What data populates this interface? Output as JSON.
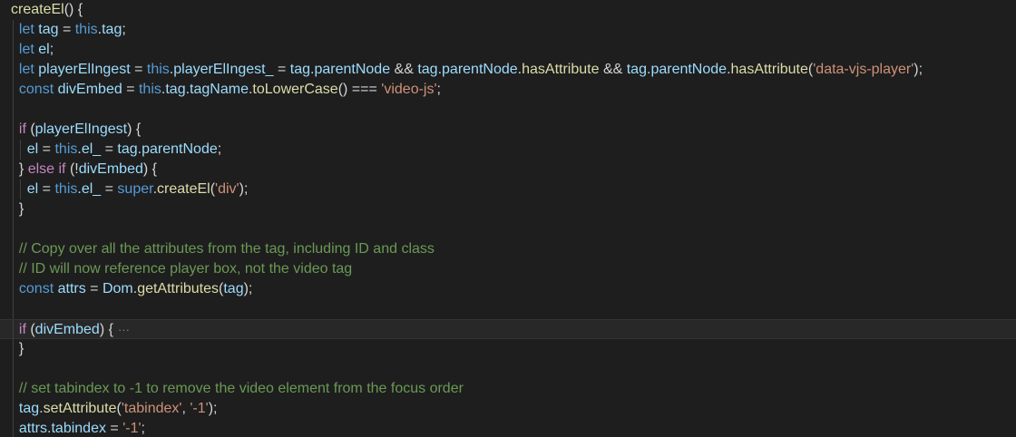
{
  "editor": {
    "lines": [
      [
        {
          "t": "createEl",
          "c": "fn"
        },
        {
          "t": "() {",
          "c": "pun"
        }
      ],
      [
        {
          "t": "  ",
          "c": "pun"
        },
        {
          "t": "let",
          "c": "kw"
        },
        {
          "t": " ",
          "c": "pun"
        },
        {
          "t": "tag",
          "c": "var"
        },
        {
          "t": " = ",
          "c": "pun"
        },
        {
          "t": "this",
          "c": "this"
        },
        {
          "t": ".",
          "c": "pun"
        },
        {
          "t": "tag",
          "c": "prop"
        },
        {
          "t": ";",
          "c": "pun"
        }
      ],
      [
        {
          "t": "  ",
          "c": "pun"
        },
        {
          "t": "let",
          "c": "kw"
        },
        {
          "t": " ",
          "c": "pun"
        },
        {
          "t": "el",
          "c": "var"
        },
        {
          "t": ";",
          "c": "pun"
        }
      ],
      [
        {
          "t": "  ",
          "c": "pun"
        },
        {
          "t": "let",
          "c": "kw"
        },
        {
          "t": " ",
          "c": "pun"
        },
        {
          "t": "playerElIngest",
          "c": "var"
        },
        {
          "t": " = ",
          "c": "pun"
        },
        {
          "t": "this",
          "c": "this"
        },
        {
          "t": ".",
          "c": "pun"
        },
        {
          "t": "playerElIngest_",
          "c": "prop"
        },
        {
          "t": " = ",
          "c": "pun"
        },
        {
          "t": "tag",
          "c": "var"
        },
        {
          "t": ".",
          "c": "pun"
        },
        {
          "t": "parentNode",
          "c": "prop"
        },
        {
          "t": " && ",
          "c": "pun"
        },
        {
          "t": "tag",
          "c": "var"
        },
        {
          "t": ".",
          "c": "pun"
        },
        {
          "t": "parentNode",
          "c": "prop"
        },
        {
          "t": ".",
          "c": "pun"
        },
        {
          "t": "hasAttribute",
          "c": "fn"
        },
        {
          "t": " && ",
          "c": "pun"
        },
        {
          "t": "tag",
          "c": "var"
        },
        {
          "t": ".",
          "c": "pun"
        },
        {
          "t": "parentNode",
          "c": "prop"
        },
        {
          "t": ".",
          "c": "pun"
        },
        {
          "t": "hasAttribute",
          "c": "fn"
        },
        {
          "t": "(",
          "c": "pun"
        },
        {
          "t": "'data-vjs-player'",
          "c": "str"
        },
        {
          "t": ");",
          "c": "pun"
        }
      ],
      [
        {
          "t": "  ",
          "c": "pun"
        },
        {
          "t": "const",
          "c": "kw"
        },
        {
          "t": " ",
          "c": "pun"
        },
        {
          "t": "divEmbed",
          "c": "var"
        },
        {
          "t": " = ",
          "c": "pun"
        },
        {
          "t": "this",
          "c": "this"
        },
        {
          "t": ".",
          "c": "pun"
        },
        {
          "t": "tag",
          "c": "prop"
        },
        {
          "t": ".",
          "c": "pun"
        },
        {
          "t": "tagName",
          "c": "prop"
        },
        {
          "t": ".",
          "c": "pun"
        },
        {
          "t": "toLowerCase",
          "c": "fn"
        },
        {
          "t": "() === ",
          "c": "pun"
        },
        {
          "t": "'video-js'",
          "c": "str"
        },
        {
          "t": ";",
          "c": "pun"
        }
      ],
      [],
      [
        {
          "t": "  ",
          "c": "pun"
        },
        {
          "t": "if",
          "c": "ctl"
        },
        {
          "t": " (",
          "c": "pun"
        },
        {
          "t": "playerElIngest",
          "c": "var"
        },
        {
          "t": ") {",
          "c": "pun"
        }
      ],
      [
        {
          "t": "    ",
          "c": "pun"
        },
        {
          "t": "el",
          "c": "var"
        },
        {
          "t": " = ",
          "c": "pun"
        },
        {
          "t": "this",
          "c": "this"
        },
        {
          "t": ".",
          "c": "pun"
        },
        {
          "t": "el_",
          "c": "prop"
        },
        {
          "t": " = ",
          "c": "pun"
        },
        {
          "t": "tag",
          "c": "var"
        },
        {
          "t": ".",
          "c": "pun"
        },
        {
          "t": "parentNode",
          "c": "prop"
        },
        {
          "t": ";",
          "c": "pun"
        }
      ],
      [
        {
          "t": "  } ",
          "c": "pun"
        },
        {
          "t": "else",
          "c": "ctl"
        },
        {
          "t": " ",
          "c": "pun"
        },
        {
          "t": "if",
          "c": "ctl"
        },
        {
          "t": " (!",
          "c": "pun"
        },
        {
          "t": "divEmbed",
          "c": "var"
        },
        {
          "t": ") {",
          "c": "pun"
        }
      ],
      [
        {
          "t": "    ",
          "c": "pun"
        },
        {
          "t": "el",
          "c": "var"
        },
        {
          "t": " = ",
          "c": "pun"
        },
        {
          "t": "this",
          "c": "this"
        },
        {
          "t": ".",
          "c": "pun"
        },
        {
          "t": "el_",
          "c": "prop"
        },
        {
          "t": " = ",
          "c": "pun"
        },
        {
          "t": "super",
          "c": "kw"
        },
        {
          "t": ".",
          "c": "pun"
        },
        {
          "t": "createEl",
          "c": "fn"
        },
        {
          "t": "(",
          "c": "pun"
        },
        {
          "t": "'div'",
          "c": "str"
        },
        {
          "t": ");",
          "c": "pun"
        }
      ],
      [
        {
          "t": "  }",
          "c": "pun"
        }
      ],
      [],
      [
        {
          "t": "  ",
          "c": "pun"
        },
        {
          "t": "// Copy over all the attributes from the tag, including ID and class",
          "c": "cmt"
        }
      ],
      [
        {
          "t": "  ",
          "c": "pun"
        },
        {
          "t": "// ID will now reference player box, not the video tag",
          "c": "cmt"
        }
      ],
      [
        {
          "t": "  ",
          "c": "pun"
        },
        {
          "t": "const",
          "c": "kw"
        },
        {
          "t": " ",
          "c": "pun"
        },
        {
          "t": "attrs",
          "c": "var"
        },
        {
          "t": " = ",
          "c": "pun"
        },
        {
          "t": "Dom",
          "c": "var"
        },
        {
          "t": ".",
          "c": "pun"
        },
        {
          "t": "getAttributes",
          "c": "fn"
        },
        {
          "t": "(",
          "c": "pun"
        },
        {
          "t": "tag",
          "c": "var"
        },
        {
          "t": ");",
          "c": "pun"
        }
      ],
      [],
      [
        {
          "t": "  ",
          "c": "pun"
        },
        {
          "t": "if",
          "c": "ctl"
        },
        {
          "t": " (",
          "c": "pun"
        },
        {
          "t": "divEmbed",
          "c": "var"
        },
        {
          "t": ") {",
          "c": "pun"
        }
      ],
      [
        {
          "t": "  }",
          "c": "pun"
        }
      ],
      [],
      [
        {
          "t": "  ",
          "c": "pun"
        },
        {
          "t": "// set tabindex to -1 to remove the video element from the focus order",
          "c": "cmt"
        }
      ],
      [
        {
          "t": "  ",
          "c": "pun"
        },
        {
          "t": "tag",
          "c": "var"
        },
        {
          "t": ".",
          "c": "pun"
        },
        {
          "t": "setAttribute",
          "c": "fn"
        },
        {
          "t": "(",
          "c": "pun"
        },
        {
          "t": "'tabindex'",
          "c": "str"
        },
        {
          "t": ", ",
          "c": "pun"
        },
        {
          "t": "'-1'",
          "c": "str"
        },
        {
          "t": ");",
          "c": "pun"
        }
      ],
      [
        {
          "t": "  ",
          "c": "pun"
        },
        {
          "t": "attrs",
          "c": "var"
        },
        {
          "t": ".",
          "c": "pun"
        },
        {
          "t": "tabindex",
          "c": "prop"
        },
        {
          "t": " = ",
          "c": "pun"
        },
        {
          "t": "'-1'",
          "c": "str"
        },
        {
          "t": ";",
          "c": "pun"
        }
      ]
    ],
    "folded_line_index": 16,
    "fold_marker": "···",
    "current_line_index": 16,
    "colors": {
      "background": "#1e1e1e",
      "keyword": "#569cd6",
      "control": "#c586c0",
      "function": "#dcdcaa",
      "variable": "#9cdcfe",
      "string": "#ce9178",
      "comment": "#6a9955",
      "punctuation": "#d4d4d4"
    }
  }
}
